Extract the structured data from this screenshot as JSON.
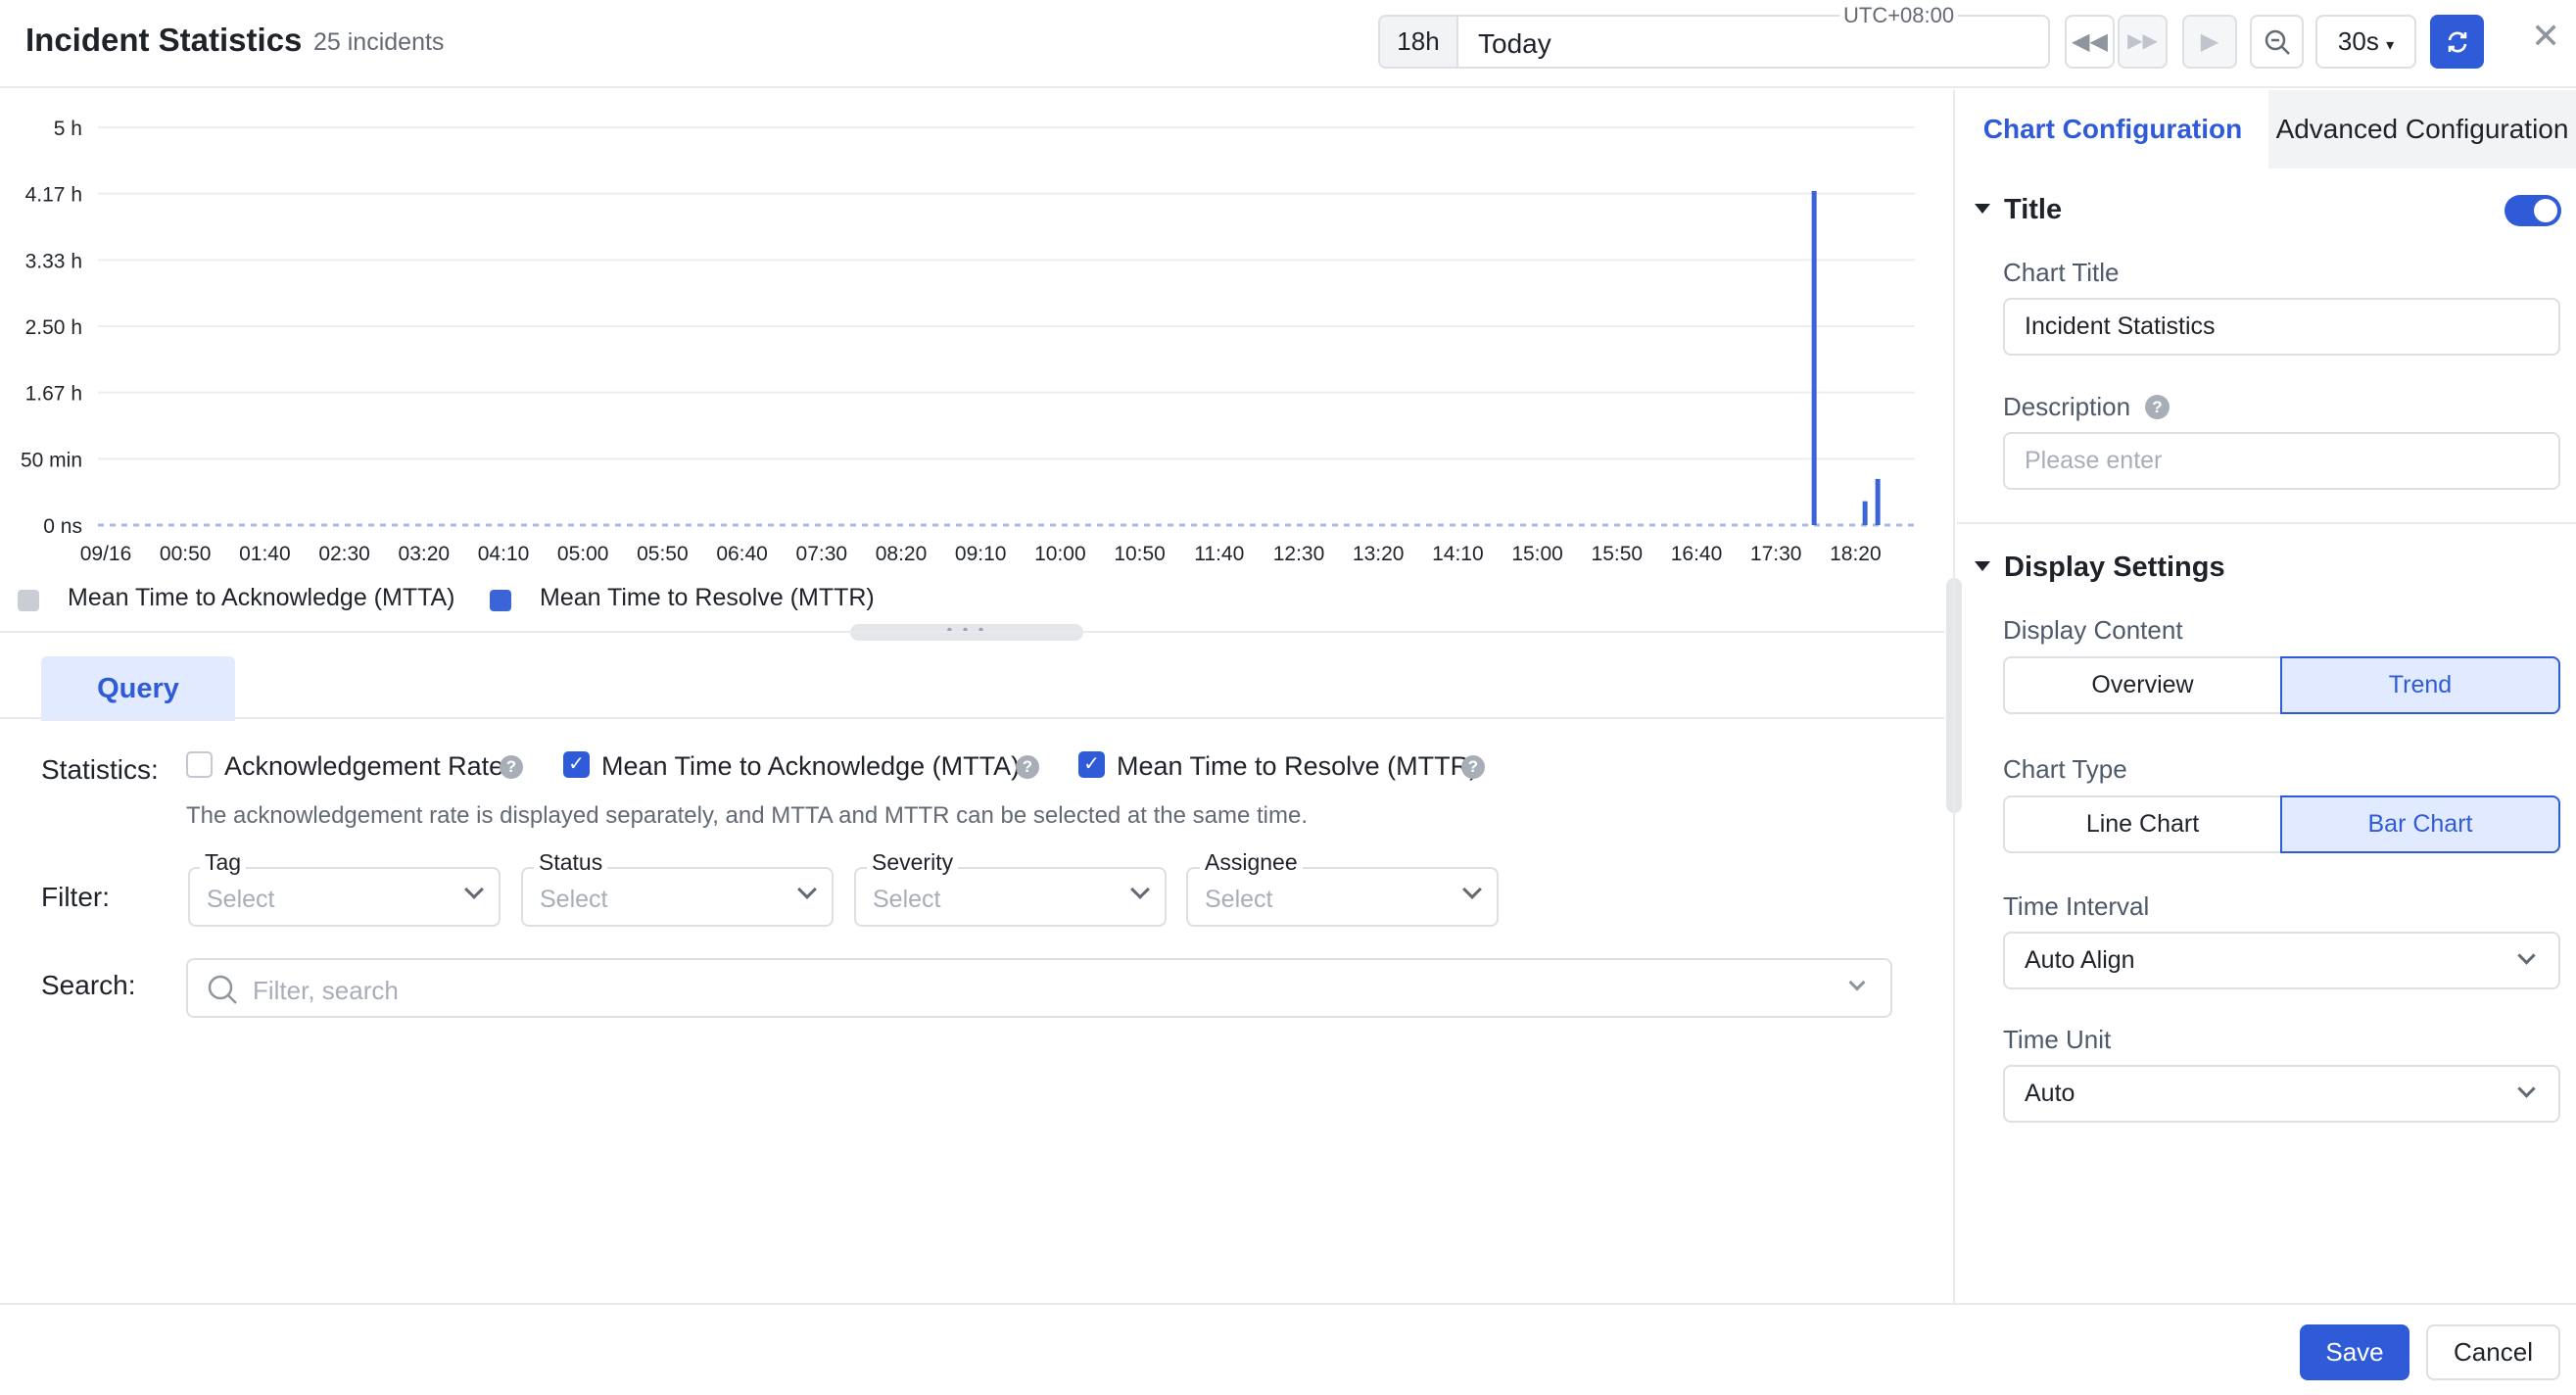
{
  "header": {
    "title": "Incident Statistics",
    "count": "25 incidents",
    "timezone": "UTC+08:00",
    "range_badge": "18h",
    "range_text": "Today",
    "refresh_interval": "30s",
    "icons": [
      "rewind-icon",
      "fast-forward-icon",
      "play-icon",
      "zoom-out-icon",
      "refresh-icon",
      "close-icon"
    ]
  },
  "chart_data": {
    "type": "bar",
    "y_ticks": [
      "5 h",
      "4.17 h",
      "3.33 h",
      "2.50 h",
      "1.67 h",
      "50 min",
      "0 ns"
    ],
    "ylim_hours": [
      0,
      5
    ],
    "x_ticks": [
      "09/16",
      "00:50",
      "01:40",
      "02:30",
      "03:20",
      "04:10",
      "05:00",
      "05:50",
      "06:40",
      "07:30",
      "08:20",
      "09:10",
      "10:00",
      "10:50",
      "11:40",
      "12:30",
      "13:20",
      "14:10",
      "15:00",
      "15:50",
      "16:40",
      "17:30",
      "18:20"
    ],
    "grid": true,
    "legend_position": "bottom-left",
    "series": [
      {
        "name": "Mean Time to Acknowledge (MTTA)",
        "color": "#c9cdd4",
        "points": []
      },
      {
        "name": "Mean Time to Resolve (MTTR)",
        "color": "#3b64d6",
        "points": [
          {
            "x": "17:54",
            "y_hours": 4.2
          },
          {
            "x": "18:26",
            "y_hours": 0.3
          },
          {
            "x": "18:34",
            "y_hours": 0.58
          }
        ]
      }
    ]
  },
  "query": {
    "tab_label": "Query",
    "statistics_label": "Statistics:",
    "options": [
      {
        "label": "Acknowledgement Rate",
        "checked": false
      },
      {
        "label": "Mean Time to Acknowledge (MTTA)",
        "checked": true
      },
      {
        "label": "Mean Time to Resolve (MTTR)",
        "checked": true
      }
    ],
    "hint": "The acknowledgement rate is displayed separately, and MTTA and MTTR can be selected at the same time.",
    "filter_label": "Filter:",
    "filters": [
      {
        "label": "Tag",
        "placeholder": "Select"
      },
      {
        "label": "Status",
        "placeholder": "Select"
      },
      {
        "label": "Severity",
        "placeholder": "Select"
      },
      {
        "label": "Assignee",
        "placeholder": "Select"
      }
    ],
    "search_label": "Search:",
    "search_placeholder": "Filter, search"
  },
  "right_panel": {
    "tab_active": "Chart Configuration",
    "tab_inactive": "Advanced Configuration",
    "title_section": "Title",
    "title_toggle_on": true,
    "chart_title_label": "Chart Title",
    "chart_title_value": "Incident Statistics",
    "description_label": "Description",
    "description_placeholder": "Please enter",
    "display_section": "Display Settings",
    "display_content_label": "Display Content",
    "display_content_options": [
      "Overview",
      "Trend"
    ],
    "display_content_selected": "Trend",
    "chart_type_label": "Chart Type",
    "chart_type_options": [
      "Line Chart",
      "Bar Chart"
    ],
    "chart_type_selected": "Bar Chart",
    "time_interval_label": "Time Interval",
    "time_interval_value": "Auto Align",
    "time_unit_label": "Time Unit",
    "time_unit_value": "Auto"
  },
  "footer": {
    "save_label": "Save",
    "cancel_label": "Cancel"
  },
  "colors": {
    "accent": "#2f5bd8",
    "mttr_bar": "#3b64d6",
    "mtta_legend": "#c9cdd4"
  }
}
